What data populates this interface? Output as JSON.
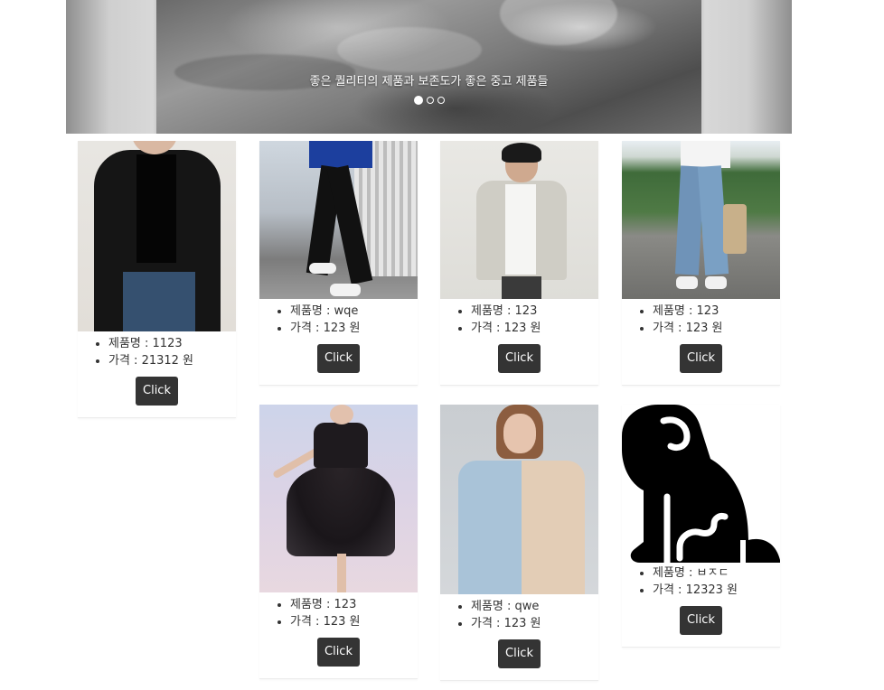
{
  "carousel": {
    "caption": "좋은 퀄리티의 제품과 보존도가 좋은 중고 제품들",
    "slide_count": 3,
    "active_index": 0
  },
  "labels": {
    "name_prefix": "제품명 : ",
    "price_prefix": "가격 : ",
    "currency_suffix": " 원"
  },
  "products": [
    {
      "name": "1123",
      "price": "21312",
      "button": "Click",
      "image": "black-blazer-photo"
    },
    {
      "name": "wqe",
      "price": "123",
      "button": "Click",
      "image": "black-track-pants-photo"
    },
    {
      "name": "123",
      "price": "123",
      "button": "Click",
      "image": "light-jacket-photo"
    },
    {
      "name": "123",
      "price": "123",
      "button": "Click",
      "image": "jeans-street-photo"
    },
    {
      "name": "123",
      "price": "123",
      "button": "Click",
      "image": "black-dress-photo"
    },
    {
      "name": "qwe",
      "price": "123",
      "button": "Click",
      "image": "two-tone-shirt-photo"
    },
    {
      "name": "ㅂㅈㄷ",
      "price": "12323",
      "button": "Click",
      "image": "dog-icon"
    }
  ],
  "product_text": [
    {
      "name": "제품명 : 1123",
      "price": "가격 : 21312 원"
    },
    {
      "name": "제품명 : wqe",
      "price": "가격 : 123 원"
    },
    {
      "name": "제품명 : 123",
      "price": "가격 : 123 원"
    },
    {
      "name": "제품명 : 123",
      "price": "가격 : 123 원"
    },
    {
      "name": "제품명 : 123",
      "price": "가격 : 123 원"
    },
    {
      "name": "제품명 : qwe",
      "price": "가격 : 123 원"
    },
    {
      "name": "제품명 : ㅂㅈㄷ",
      "price": "가격 : 12323 원"
    }
  ]
}
